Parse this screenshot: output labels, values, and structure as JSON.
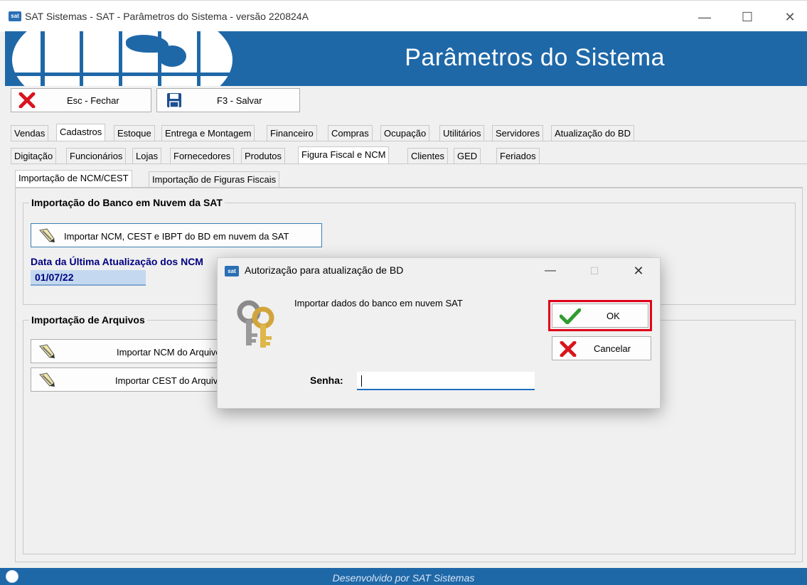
{
  "window": {
    "title": "SAT Sistemas - SAT - Parâmetros do Sistema - versão 220824A",
    "icon_label": "sat"
  },
  "banner": {
    "title": "Parâmetros do Sistema"
  },
  "toolbar": {
    "close_label": "Esc - Fechar",
    "save_label": "F3 - Salvar"
  },
  "main_tabs": [
    "Vendas",
    "Cadastros",
    "Estoque",
    "Entrega e Montagem",
    "Financeiro",
    "Compras",
    "Ocupação",
    "Utilitários",
    "Servidores",
    "Atualização do BD"
  ],
  "main_tab_active": "Cadastros",
  "sub_tabs": [
    "Digitação",
    "Funcionários",
    "Lojas",
    "Fornecedores",
    "Produtos",
    "Figura Fiscal e NCM",
    "Clientes",
    "GED",
    "Feriados"
  ],
  "sub_tab_active": "Figura Fiscal e NCM",
  "inner_tabs": [
    "Importação de NCM/CEST",
    "Importação de Figuras Fiscais"
  ],
  "inner_tab_active": "Importação de NCM/CEST",
  "cloud_group": {
    "title": "Importação do Banco em Nuvem da SAT",
    "import_button": "Importar NCM, CEST e IBPT do BD em nuvem da SAT",
    "date_label": "Data da Última Atualização dos NCM",
    "date_value": "01/07/22"
  },
  "files_group": {
    "title": "Importação de Arquivos",
    "import_ncm_button": "Importar NCM do Arquivo",
    "import_cest_button": "Importar CEST do Arquivo"
  },
  "status_bar": {
    "text": "Desenvolvido por SAT Sistemas"
  },
  "dialog": {
    "title": "Autorização para atualização de BD",
    "message": "Importar dados do banco em nuvem SAT",
    "password_label": "Senha:",
    "password_value": "",
    "ok_label": "OK",
    "cancel_label": "Cancelar",
    "highlight_color": "#e0001b"
  }
}
